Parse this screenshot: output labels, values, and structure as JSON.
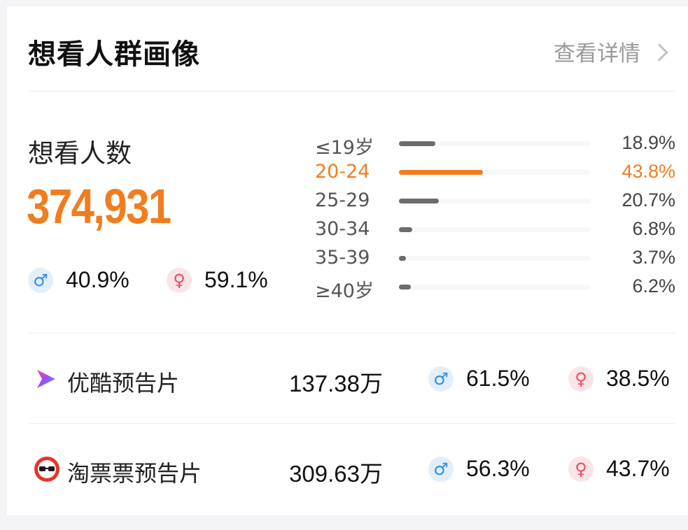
{
  "header": {
    "title": "想看人群画像",
    "detail_link": "查看详情",
    "detail_icon": "chevron-right-icon"
  },
  "summary": {
    "label": "想看人数",
    "count": "374,931",
    "male_pct": "40.9%",
    "female_pct": "59.1%",
    "male_icon": "male-icon",
    "female_icon": "female-icon"
  },
  "ages": [
    {
      "label": "≤19岁",
      "pct": "18.9%",
      "value": 18.9,
      "highlight": false
    },
    {
      "label": "20-24",
      "pct": "43.8%",
      "value": 43.8,
      "highlight": true
    },
    {
      "label": "25-29",
      "pct": "20.7%",
      "value": 20.7,
      "highlight": false
    },
    {
      "label": "30-34",
      "pct": "6.8%",
      "value": 6.8,
      "highlight": false
    },
    {
      "label": "35-39",
      "pct": "3.7%",
      "value": 3.7,
      "highlight": false
    },
    {
      "label": "≥40岁",
      "pct": "6.2%",
      "value": 6.2,
      "highlight": false
    }
  ],
  "platforms": [
    {
      "name": "优酷预告片",
      "count": "137.38万",
      "male_pct": "61.5%",
      "female_pct": "38.5%",
      "logo_icon": "youku-logo-icon"
    },
    {
      "name": "淘票票预告片",
      "count": "309.63万",
      "male_pct": "56.3%",
      "female_pct": "43.7%",
      "logo_icon": "taopiaopiao-logo-icon"
    }
  ],
  "colors": {
    "accent": "#f07d1f",
    "male": "#2f8de4",
    "female": "#ee4b5c",
    "bar": "#6c6c6c"
  }
}
